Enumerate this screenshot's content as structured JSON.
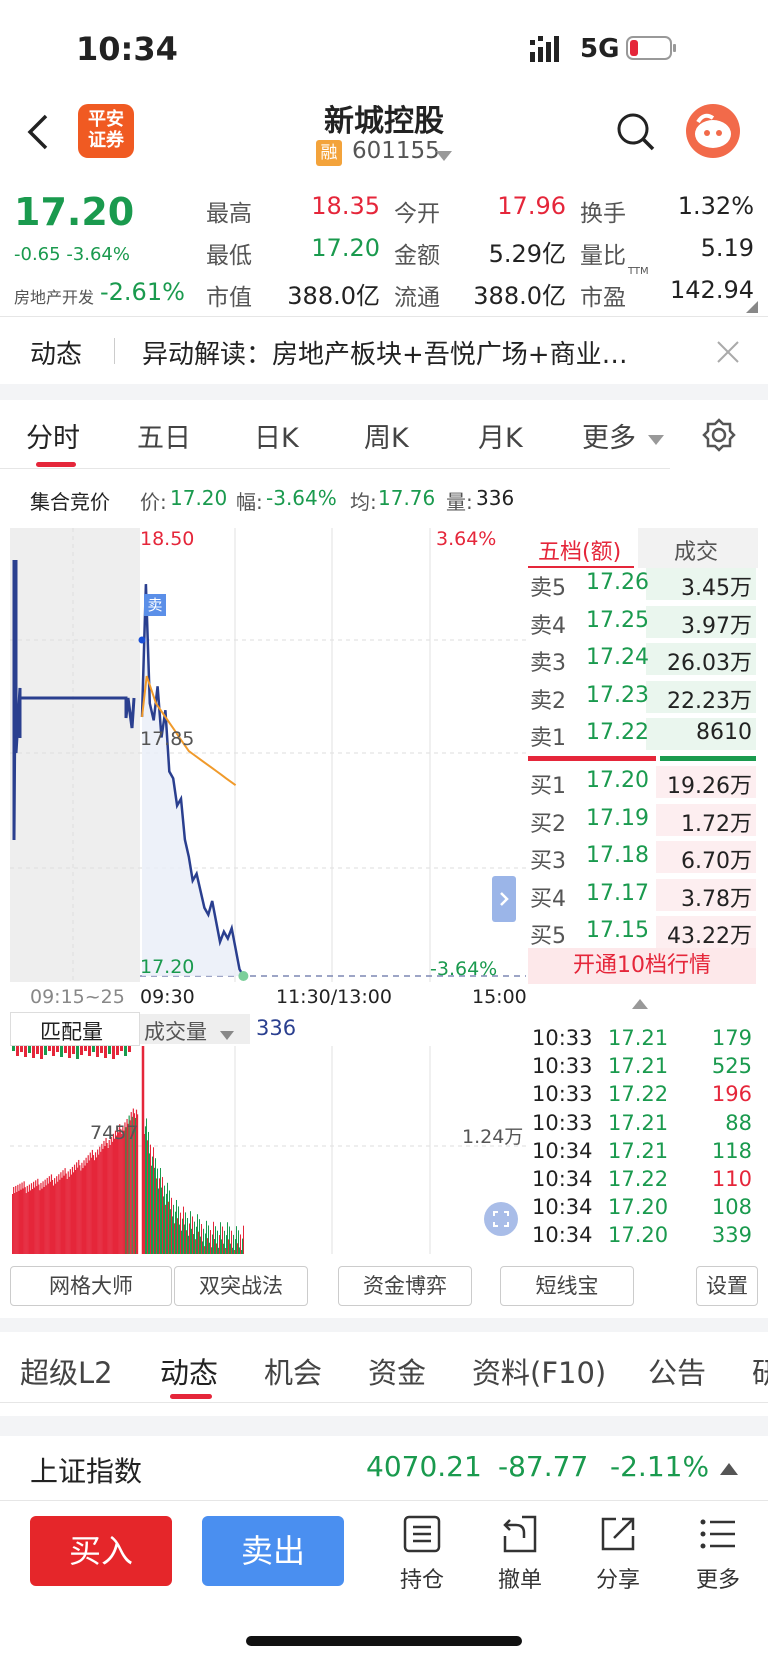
{
  "status": {
    "time": "10:34",
    "network": "5G"
  },
  "nav": {
    "back_icon": "chevron-left-icon",
    "logo_text": "平安\n证券",
    "stock_name": "新城控股",
    "margin_badge": "融",
    "stock_code": "601155",
    "search_icon": "search-icon",
    "assistant_icon": "chat-avatar-icon"
  },
  "quote": {
    "price": "17.20",
    "change": "-0.65",
    "change_pct": "-3.64%",
    "sector_name": "房地产开发",
    "sector_pct": "-2.61%",
    "stats": [
      {
        "label": "最高",
        "value": "18.35",
        "color": "red"
      },
      {
        "label": "今开",
        "value": "17.96",
        "color": "red"
      },
      {
        "label": "换手",
        "value": "1.32%",
        "color": "black"
      },
      {
        "label": "最低",
        "value": "17.20",
        "color": "green"
      },
      {
        "label": "金额",
        "value": "5.29亿",
        "color": "black"
      },
      {
        "label": "量比",
        "value": "5.19",
        "color": "black"
      },
      {
        "label": "市值",
        "value": "388.0亿",
        "color": "black"
      },
      {
        "label": "流通",
        "value": "388.0亿",
        "color": "black"
      },
      {
        "label": "市盈",
        "value": "142.94",
        "color": "black"
      }
    ],
    "ttm": "TTM"
  },
  "news": {
    "tag": "动态",
    "text": "异动解读：房地产板块+吾悦广场+商业…"
  },
  "chart_tabs": {
    "items": [
      "分时",
      "五日",
      "日K",
      "周K",
      "月K",
      "更多"
    ],
    "active": 0
  },
  "auction_bar": {
    "title": "集合竞价",
    "price_label": "价:",
    "price": "17.20",
    "pct_label": "幅:",
    "pct": "-3.64%",
    "avg_label": "均:",
    "avg": "17.76",
    "vol_label": "量:",
    "vol": "336"
  },
  "chart_labels": {
    "top_price": "18.50",
    "top_pct": "3.64%",
    "mid_price": "17.85",
    "bottom_price": "17.20",
    "bottom_pct": "-3.64%",
    "sell_marker": "卖",
    "time_auction": "09:15~25",
    "time_open": "09:30",
    "time_mid": "11:30/13:00",
    "time_close": "15:00",
    "match_label": "匹配量",
    "vol_selector": "成交量",
    "vol_value": "336",
    "vol_left_peak": "7457",
    "vol_right_scale": "1.24万"
  },
  "chart_data": {
    "type": "line",
    "title": "",
    "ylim": [
      17.2,
      18.5
    ],
    "series": [
      {
        "values": [
          17.96,
          18.35,
          18.0,
          17.95,
          18.05,
          17.9,
          17.98,
          17.8,
          17.78,
          17.7,
          17.72,
          17.6,
          17.55,
          17.48,
          17.5,
          17.45,
          17.4,
          17.38,
          17.42,
          17.36,
          17.3,
          17.33,
          17.31,
          17.34,
          17.28,
          17.22,
          17.2
        ]
      },
      {
        "values": [
          17.96,
          18.08,
          18.04,
          18.0,
          17.98,
          17.96,
          17.94,
          17.92,
          17.9,
          17.88,
          17.86,
          17.85,
          17.84,
          17.83,
          17.82,
          17.81,
          17.8,
          17.79,
          17.78,
          17.77,
          17.76
        ]
      }
    ]
  },
  "orderbook": {
    "tab_active": "五档(额)",
    "tab_other": "成交",
    "sells": [
      {
        "label": "卖5",
        "price": "17.26",
        "amount": "3.45万"
      },
      {
        "label": "卖4",
        "price": "17.25",
        "amount": "3.97万"
      },
      {
        "label": "卖3",
        "price": "17.24",
        "amount": "26.03万"
      },
      {
        "label": "卖2",
        "price": "17.23",
        "amount": "22.23万"
      },
      {
        "label": "卖1",
        "price": "17.22",
        "amount": "8610"
      }
    ],
    "buys": [
      {
        "label": "买1",
        "price": "17.20",
        "amount": "19.26万"
      },
      {
        "label": "买2",
        "price": "17.19",
        "amount": "1.72万"
      },
      {
        "label": "买3",
        "price": "17.18",
        "amount": "6.70万"
      },
      {
        "label": "买4",
        "price": "17.17",
        "amount": "3.78万"
      },
      {
        "label": "买5",
        "price": "17.15",
        "amount": "43.22万"
      }
    ],
    "open_l2": "开通10档行情"
  },
  "ticks": [
    {
      "time": "10:33",
      "price": "17.21",
      "vol": "179",
      "color": "green"
    },
    {
      "time": "10:33",
      "price": "17.21",
      "vol": "525",
      "color": "green"
    },
    {
      "time": "10:33",
      "price": "17.22",
      "vol": "196",
      "color": "red"
    },
    {
      "time": "10:33",
      "price": "17.21",
      "vol": "88",
      "color": "green"
    },
    {
      "time": "10:34",
      "price": "17.21",
      "vol": "118",
      "color": "green"
    },
    {
      "time": "10:34",
      "price": "17.22",
      "vol": "110",
      "color": "red"
    },
    {
      "time": "10:34",
      "price": "17.20",
      "vol": "108",
      "color": "green"
    },
    {
      "time": "10:34",
      "price": "17.20",
      "vol": "339",
      "color": "green"
    }
  ],
  "tools": [
    "网格大师",
    "双突战法",
    "资金博弈",
    "短线宝",
    "设置"
  ],
  "bottom_tabs": {
    "items": [
      "超级L2",
      "动态",
      "机会",
      "资金",
      "资料(F10)",
      "公告",
      "研"
    ],
    "active": 1
  },
  "index_bar": {
    "name": "上证指数",
    "value": "4070.21",
    "change": "-87.77",
    "pct": "-2.11%"
  },
  "action_bar": {
    "buy": "买入",
    "sell": "卖出",
    "items": [
      {
        "label": "持仓",
        "icon": "holdings-icon"
      },
      {
        "label": "撤单",
        "icon": "cancel-order-icon"
      },
      {
        "label": "分享",
        "icon": "share-icon"
      },
      {
        "label": "更多",
        "icon": "menu-icon"
      }
    ]
  }
}
